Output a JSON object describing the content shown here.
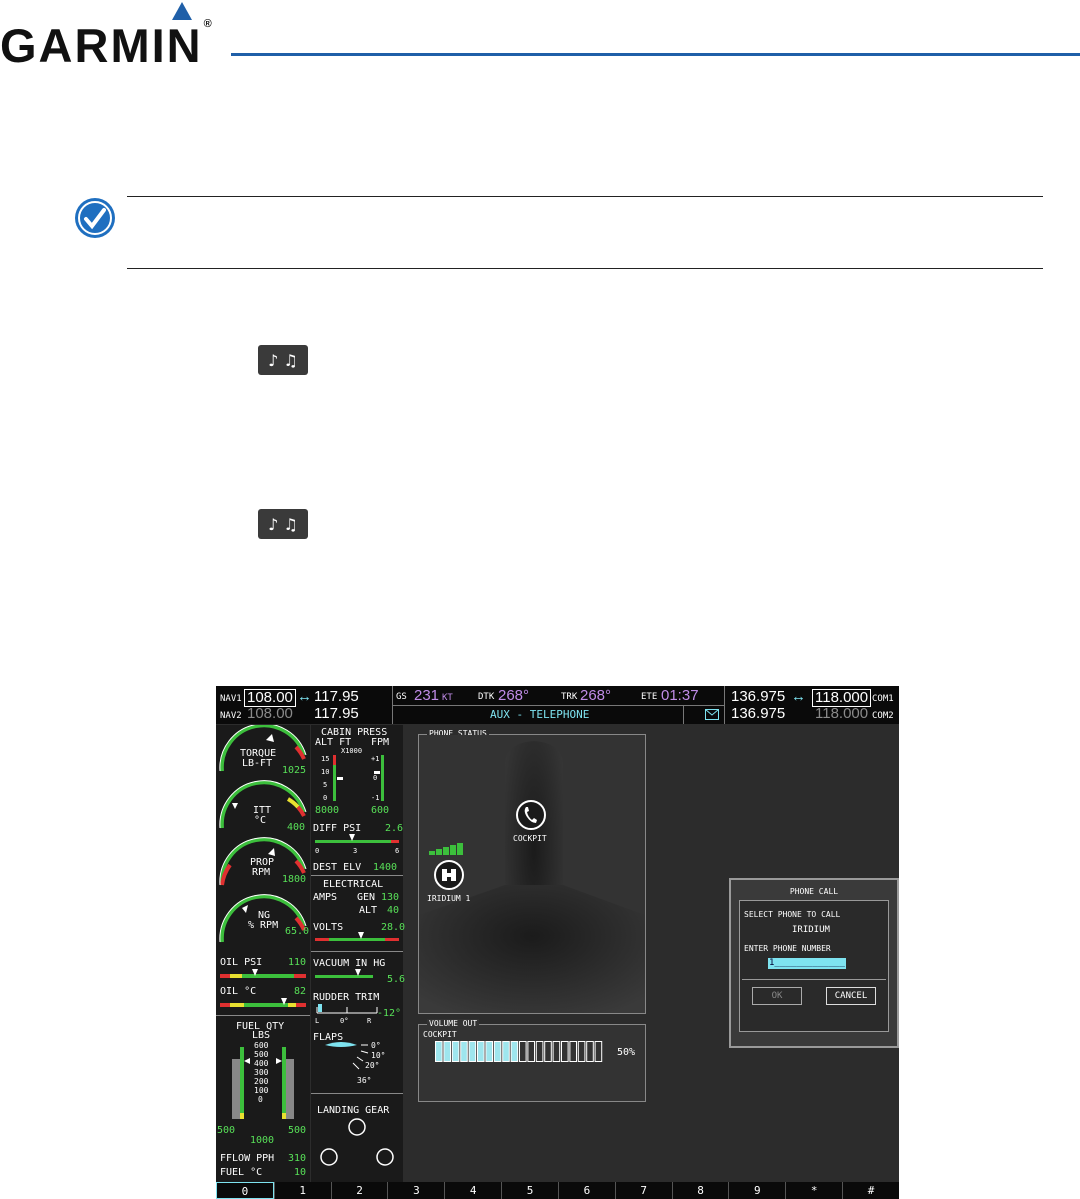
{
  "header": {
    "brand": "GARMIN",
    "trademark": "®"
  },
  "icons": {
    "note": "check-note-icon",
    "media_key": "music-notes-icon"
  },
  "colors": {
    "brand_blue": "#1f5fa8",
    "accent_cyan": "#7ee3f0",
    "value_green": "#58e058",
    "magenta": "#c08ce8"
  },
  "mfd": {
    "nav": {
      "nav1_label": "NAV1",
      "nav1_active": "108.00",
      "nav1_standby": "117.95",
      "nav2_label": "NAV2",
      "nav2_active": "108.00",
      "nav2_standby": "117.95",
      "swap": "↔"
    },
    "nav_data": {
      "gs_label": "GS",
      "gs_value": "231",
      "gs_unit": "KT",
      "dtk_label": "DTK",
      "dtk_value": "268°",
      "trk_label": "TRK",
      "trk_value": "268°",
      "ete_label": "ETE",
      "ete_value": "01:37",
      "page_title": "AUX - TELEPHONE"
    },
    "com": {
      "com1_label": "COM1",
      "com1_active": "136.975",
      "com1_standby": "118.000",
      "com2_label": "COM2",
      "com2_active": "136.975",
      "com2_standby": "118.000",
      "swap": "↔"
    },
    "engine": {
      "torque_label": "TORQUE",
      "torque_unit": "LB-FT",
      "torque_value": "1025",
      "itt_label": "ITT",
      "itt_unit": "°C",
      "itt_value": "400",
      "prop_label": "PROP",
      "prop_unit": "RPM",
      "prop_value": "1800",
      "ng_label": "NG",
      "ng_unit": "% RPM",
      "ng_value": "65.0",
      "oil_psi_label": "OIL PSI",
      "oil_psi_value": "110",
      "oil_c_label": "OIL °C",
      "oil_c_value": "82",
      "fuel_qty_label": "FUEL QTY",
      "fuel_qty_unit": "LBS",
      "fuel_scale": [
        "600",
        "500",
        "400",
        "300",
        "200",
        "100",
        "0"
      ],
      "fuel_left": "500",
      "fuel_right": "500",
      "fuel_total": "1000",
      "fflow_label": "FFLOW PPH",
      "fflow_value": "310",
      "fuel_c_label": "FUEL °C",
      "fuel_c_value": "10"
    },
    "systems": {
      "cabin_label": "CABIN PRESS",
      "alt_ft_label": "ALT FT",
      "fpm_label": "FPM",
      "x1000": "X1000",
      "alt_scale": [
        "15",
        "10",
        "5",
        "0"
      ],
      "fpm_scale": [
        "+1",
        "0",
        "-1"
      ],
      "cabin_alt": "8000",
      "cabin_fpm": "600",
      "diff_psi_label": "DIFF PSI",
      "diff_psi_value": "2.6",
      "diff_scale": [
        "0",
        "3",
        "6"
      ],
      "dest_elv_label": "DEST ELV",
      "dest_elv_value": "1400",
      "electrical_label": "ELECTRICAL",
      "amps_label": "AMPS",
      "gen_label": "GEN",
      "gen_value": "130",
      "alt_label": "ALT",
      "alt_value": "40",
      "volts_label": "VOLTS",
      "volts_value": "28.0",
      "vacuum_label": "VACUUM IN HG",
      "vacuum_value": "5.6",
      "rudder_label": "RUDDER TRIM",
      "rudder_value": "-12°",
      "rudder_scale": [
        "L",
        "0°",
        "R"
      ],
      "flaps_label": "FLAPS",
      "flaps_marks": [
        "0°",
        "10°",
        "20°",
        "36°"
      ],
      "gear_label": "LANDING GEAR"
    },
    "phone_status": {
      "title": "PHONE STATUS",
      "cockpit": "COCKPIT",
      "iridium": "IRIDIUM 1"
    },
    "volume": {
      "title": "VOLUME OUT",
      "channel": "COCKPIT",
      "percent": "50%",
      "level": 0.5,
      "segments": 20
    },
    "dialog": {
      "title": "PHONE CALL",
      "select_label": "SELECT PHONE TO CALL",
      "selected_phone": "IRIDIUM",
      "enter_label": "ENTER PHONE NUMBER",
      "number_value": "1_____________",
      "ok": "OK",
      "cancel": "CANCEL"
    },
    "softkeys": [
      "0",
      "1",
      "2",
      "3",
      "4",
      "5",
      "6",
      "7",
      "8",
      "9",
      "*",
      "#"
    ]
  }
}
